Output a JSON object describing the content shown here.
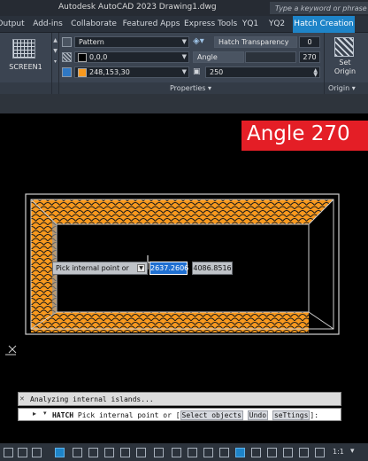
{
  "window": {
    "title": "Autodesk AutoCAD 2023    Drawing1.dwg",
    "search_placeholder": "Type a keyword or phrase"
  },
  "tabs": [
    "Output",
    "Add-ins",
    "Collaborate",
    "Featured Apps",
    "Express Tools",
    "YQ1",
    "YQ2",
    "Hatch Creation"
  ],
  "active_tab": "Hatch Creation",
  "ribbon": {
    "pattern_label": "SCREEN1",
    "hatch_type": "Pattern",
    "hatch_color": "0,0,0",
    "background_color": "248,153,30",
    "background_swatch": "#f8991e",
    "transparency_label": "Hatch Transparency",
    "transparency_value": "0",
    "angle_label": "Angle",
    "angle_value": "270",
    "scale_value": "250",
    "set_origin_label": "Set Origin",
    "properties_label": "Properties",
    "origin_label": "Origin"
  },
  "canvas": {
    "banner_text": "Angle 270",
    "banner_color": "#e41e26",
    "hatch_fill": "#f8991e",
    "tooltip_prompt": "Pick internal point or",
    "coord_x": "2637.2606",
    "coord_y": "4086.8516"
  },
  "command_line": {
    "history": "Analyzing internal islands...",
    "command": "HATCH",
    "prompt": "Pick internal point or [",
    "options": [
      "Select objects",
      "Undo",
      "seTtings"
    ],
    "suffix": "]:"
  },
  "statusbar": {
    "scale": "1:1"
  }
}
